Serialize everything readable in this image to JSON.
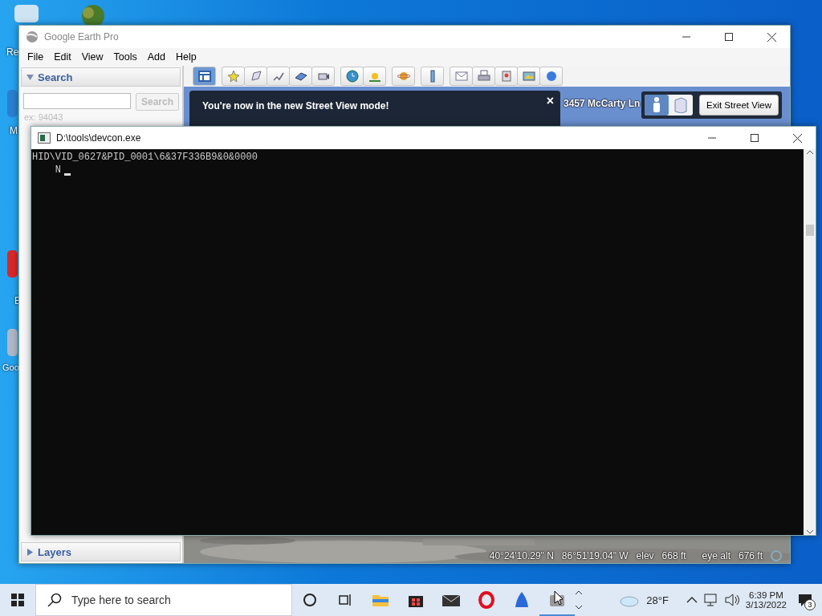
{
  "desktop": {
    "icons": [
      {
        "label": "Re"
      },
      {
        "label": "M"
      },
      {
        "label": "E"
      },
      {
        "label": "Goo"
      }
    ]
  },
  "earth_window": {
    "title": "Google Earth Pro",
    "menu": [
      "File",
      "Edit",
      "View",
      "Tools",
      "Add",
      "Help"
    ],
    "search_panel": {
      "title": "Search",
      "expanded": true,
      "button": "Search",
      "hint": "ex: 94043"
    },
    "layers_panel": {
      "title": "Layers",
      "expanded": false
    },
    "tip": {
      "title": "You're now in the new Street View mode!",
      "close": "×"
    },
    "address": "3457 McCarty Ln",
    "view_toggle": [
      {
        "kind": "person",
        "selected": true
      },
      {
        "kind": "building",
        "selected": false
      }
    ],
    "exit_button": "Exit Street View",
    "status": {
      "latitude": "40°24'10.29\" N",
      "longitude": "86°51'19.04\" W",
      "elev_label": "elev",
      "elev": "668 ft",
      "alt_label": "eye alt",
      "alt": "676 ft"
    }
  },
  "console": {
    "title": "D:\\tools\\devcon.exe",
    "lines": [
      "HID\\VID_0627&PID_0001\\6&37F336B9&0&0000",
      "    N"
    ]
  },
  "taskbar": {
    "search_placeholder": "Type here to search",
    "weather": "28°F",
    "time": "6:39 PM",
    "date": "3/13/2022",
    "notifications": "3"
  }
}
